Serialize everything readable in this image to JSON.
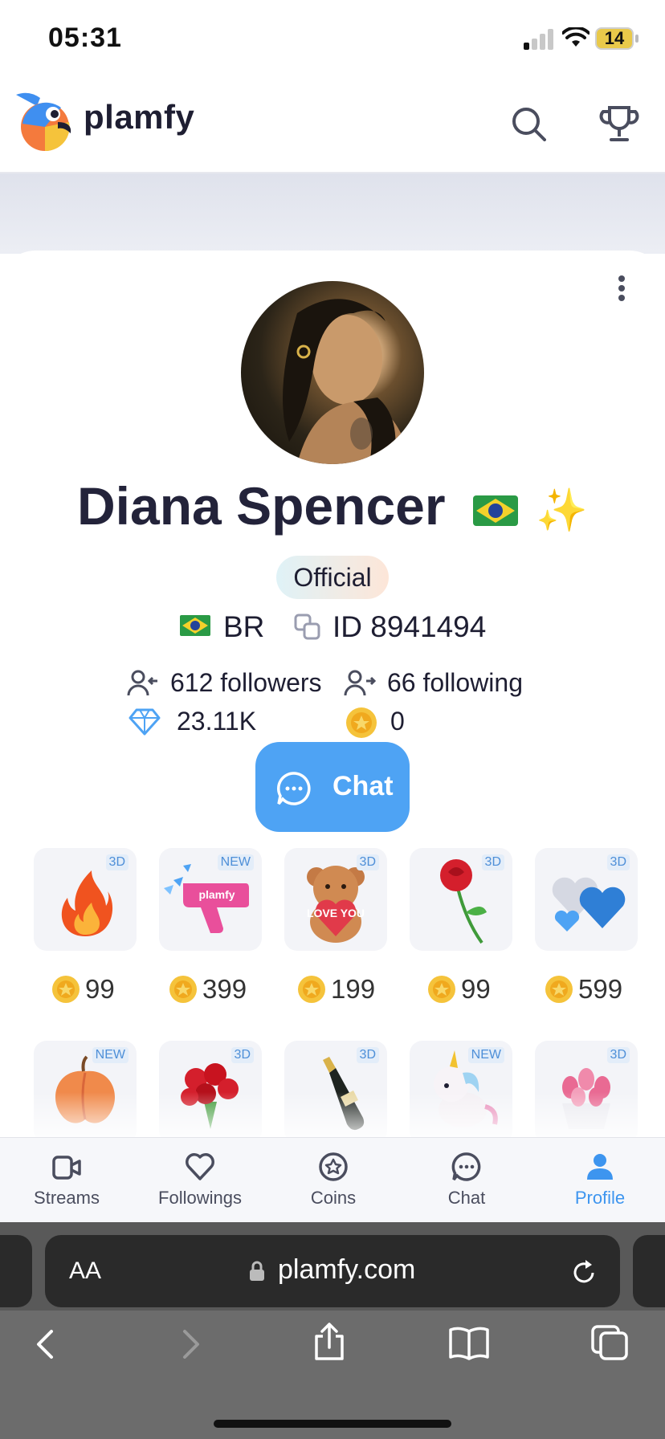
{
  "status_bar": {
    "time": "05:31",
    "battery": "14"
  },
  "header": {
    "brand": "plamfy"
  },
  "profile": {
    "name": "Diana Spencer",
    "badge": "Official",
    "country_code": "BR",
    "user_id": "ID 8941494",
    "followers": "612 followers",
    "following": "66 following",
    "diamonds": "23.11K",
    "coins": "0",
    "chat_label": "Chat"
  },
  "gifts": [
    {
      "name": "fire",
      "tag": "3D",
      "price": "99"
    },
    {
      "name": "money-gun",
      "tag": "NEW",
      "price": "399",
      "art_text": "plamfy"
    },
    {
      "name": "teddy-bear",
      "tag": "3D",
      "price": "199",
      "art_text": "LOVE YOU"
    },
    {
      "name": "rose",
      "tag": "3D",
      "price": "99"
    },
    {
      "name": "heart-balloons",
      "tag": "3D",
      "price": "599"
    },
    {
      "name": "peach",
      "tag": "NEW"
    },
    {
      "name": "rose-bouquet",
      "tag": "3D"
    },
    {
      "name": "champagne",
      "tag": "3D"
    },
    {
      "name": "unicorn",
      "tag": "NEW"
    },
    {
      "name": "tulips",
      "tag": "3D"
    }
  ],
  "tab_bar": {
    "items": [
      {
        "label": "Streams",
        "icon": "streams-icon"
      },
      {
        "label": "Followings",
        "icon": "heart-icon"
      },
      {
        "label": "Coins",
        "icon": "star-coin-icon"
      },
      {
        "label": "Chat",
        "icon": "chat-icon"
      },
      {
        "label": "Profile",
        "icon": "profile-icon",
        "active": true
      }
    ]
  },
  "browser": {
    "text_size": "AA",
    "url": "plamfy.com"
  },
  "colors": {
    "accent": "#4ea3f4",
    "coin": "#f2c230"
  }
}
